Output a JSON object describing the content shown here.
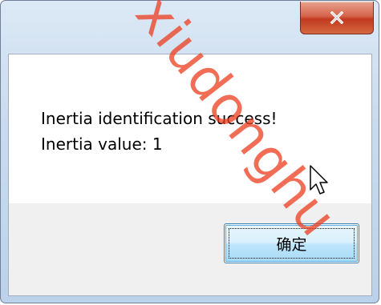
{
  "dialog": {
    "close_icon": "close-x-icon",
    "message_line_1": "Inertia identification success!",
    "message_line_2": "Inertia value: 1",
    "ok_label": "确定",
    "watermark": "xiudonghu"
  },
  "colors": {
    "close_button": "#c13a20",
    "ok_button_border": "#3c7fb1",
    "watermark": "#ec3c1e"
  }
}
